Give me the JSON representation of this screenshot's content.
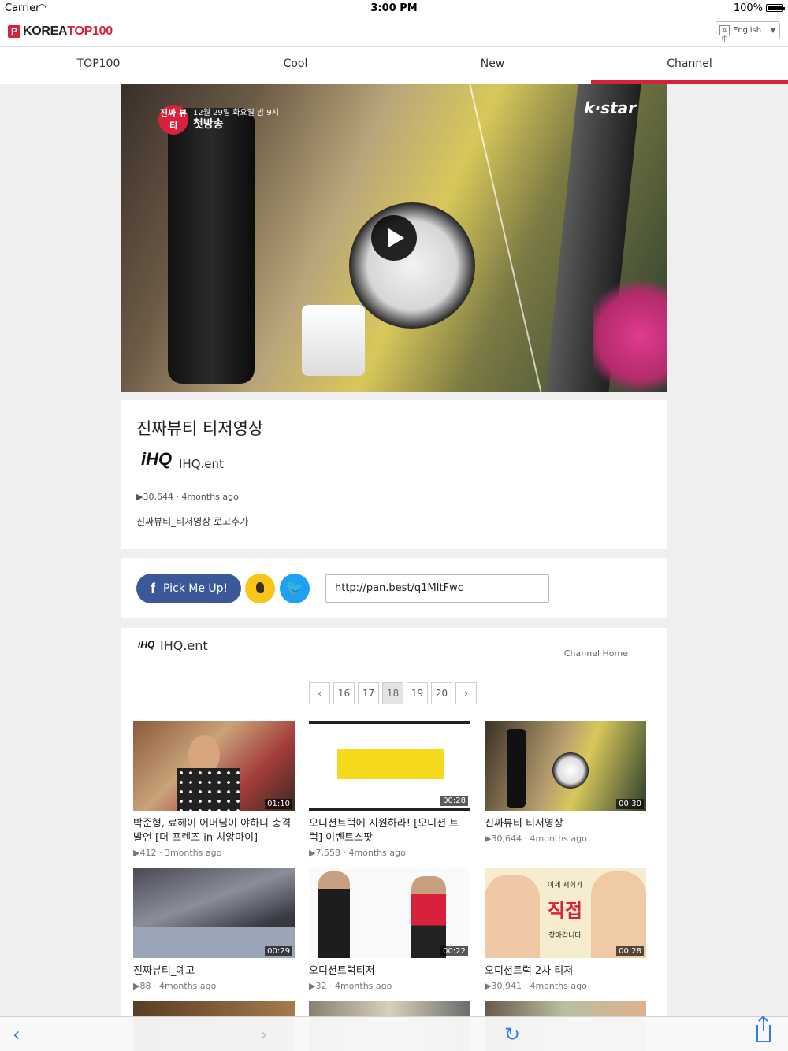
{
  "status_bar": {
    "carrier": "Carrier",
    "time": "3:00 PM",
    "battery": "100%"
  },
  "header": {
    "logo_p": "P",
    "logo_korea": "KOREA",
    "logo_top100": "TOP100",
    "language": "English",
    "lang_icon": "A中"
  },
  "tabs": [
    {
      "label": "TOP100"
    },
    {
      "label": "Cool"
    },
    {
      "label": "New"
    },
    {
      "label": "Channel",
      "active": true
    }
  ],
  "video": {
    "badge": "진짜 뷰티",
    "caption_line1": "12월 29일 화요일 밤 9시",
    "caption_line2": "첫방송",
    "brand": "k·star"
  },
  "info": {
    "title": "진짜뷰티 티저영상",
    "channel_logo": "iHQ",
    "channel_name": "IHQ.ent",
    "views": "30,644",
    "age": "4months ago",
    "description": "진짜뷰티_티저영상 로고추가"
  },
  "share": {
    "facebook_label": "Pick Me Up!",
    "facebook_icon": "f",
    "twitter_icon": "🐦",
    "url": "http://pan.best/q1MItFwc"
  },
  "channel_list": {
    "logo": "iHQ",
    "name": "IHQ.ent",
    "home_link": "Channel Home",
    "pages": [
      "16",
      "17",
      "18",
      "19",
      "20"
    ],
    "active_page": "18",
    "prev_icon": "‹",
    "next_icon": "›",
    "videos": [
      {
        "title": "박준형, 료헤이 어머님이 야하니 충격 발언 [더 프렌즈 in 치앙마이]",
        "duration": "01:10",
        "views": "412",
        "age": "3months ago"
      },
      {
        "title": "오디션트럭에 지원하라! [오디션 트럭] 이벤트스팟",
        "duration": "00:28",
        "views": "7,558",
        "age": "4months ago"
      },
      {
        "title": "진짜뷰티 티저영상",
        "duration": "00:30",
        "views": "30,644",
        "age": "4months ago"
      },
      {
        "title": "진짜뷰티_예고",
        "duration": "00:29",
        "views": "88",
        "age": "4months ago"
      },
      {
        "title": "오디션트럭티저",
        "duration": "00:22",
        "views": "32",
        "age": "4months ago"
      },
      {
        "title": "오디션트럭 2차 티저",
        "duration": "00:28",
        "views": "30,941",
        "age": "4months ago"
      }
    ],
    "thumb_texts": {
      "t6_top": "이제 저희가",
      "t6_main": "직접",
      "t6_bottom": "찾아갑니다"
    }
  },
  "toolbar": {
    "back_icon": "‹",
    "forward_icon": "›",
    "reload_icon": "↻"
  },
  "colors": {
    "accent": "#d8213b",
    "facebook": "#3b5998",
    "kakao": "#f9c518",
    "twitter": "#1da1f2",
    "ios_blue": "#2e7cf6"
  }
}
